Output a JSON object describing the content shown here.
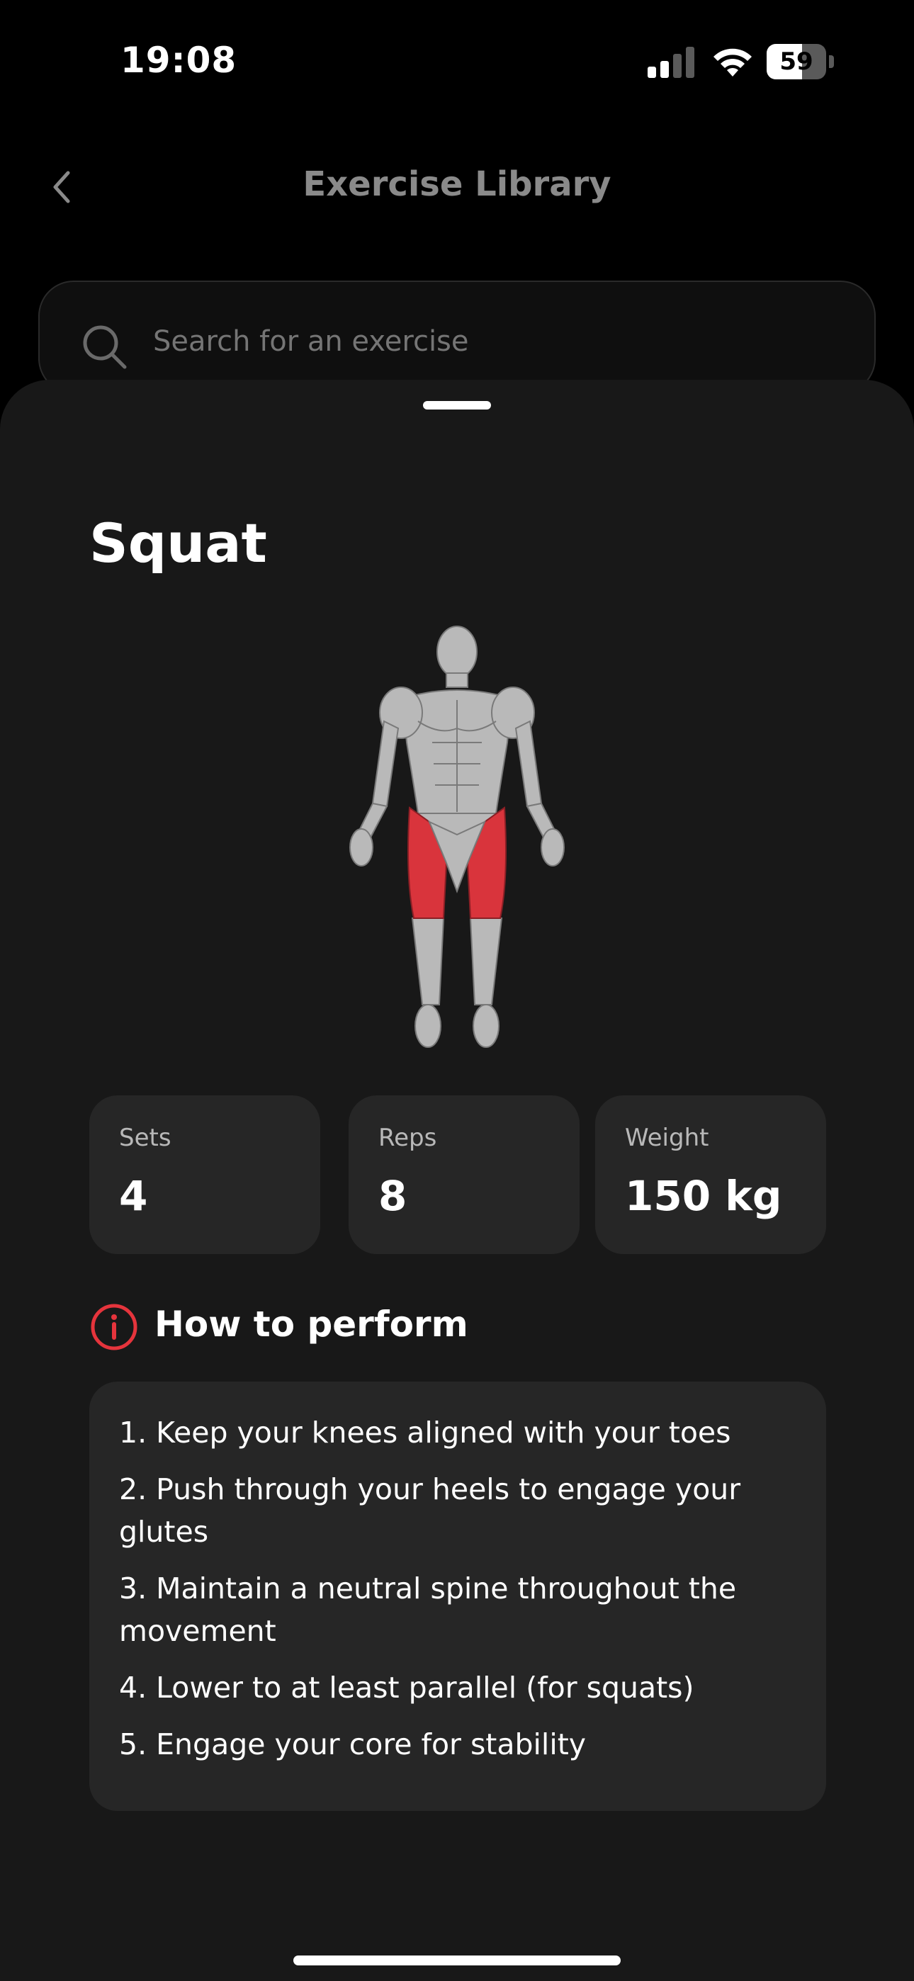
{
  "status_bar": {
    "time": "19:08",
    "battery_level": "59",
    "battery_fraction": 0.59
  },
  "header": {
    "title": "Exercise Library",
    "back_icon": "chevron-left-icon"
  },
  "search": {
    "placeholder": "Search for an exercise",
    "value": ""
  },
  "exercise": {
    "name": "Squat",
    "highlighted_muscles": "quadriceps",
    "highlight_color": "#d9343c"
  },
  "stats": [
    {
      "label": "Sets",
      "value": "4"
    },
    {
      "label": "Reps",
      "value": "8"
    },
    {
      "label": "Weight",
      "value": "150 kg"
    }
  ],
  "how_to": {
    "title": "How to perform",
    "icon": "info-icon",
    "accent": "#e5343c",
    "steps": [
      "1. Keep your knees aligned with your toes",
      "2. Push through your heels to engage your glutes",
      "3. Maintain a neutral spine throughout the movement",
      "4. Lower to at least parallel (for squats)",
      "5. Engage your core for stability"
    ]
  },
  "colors": {
    "background": "#000000",
    "sheet": "#181818",
    "card": "#262626"
  }
}
